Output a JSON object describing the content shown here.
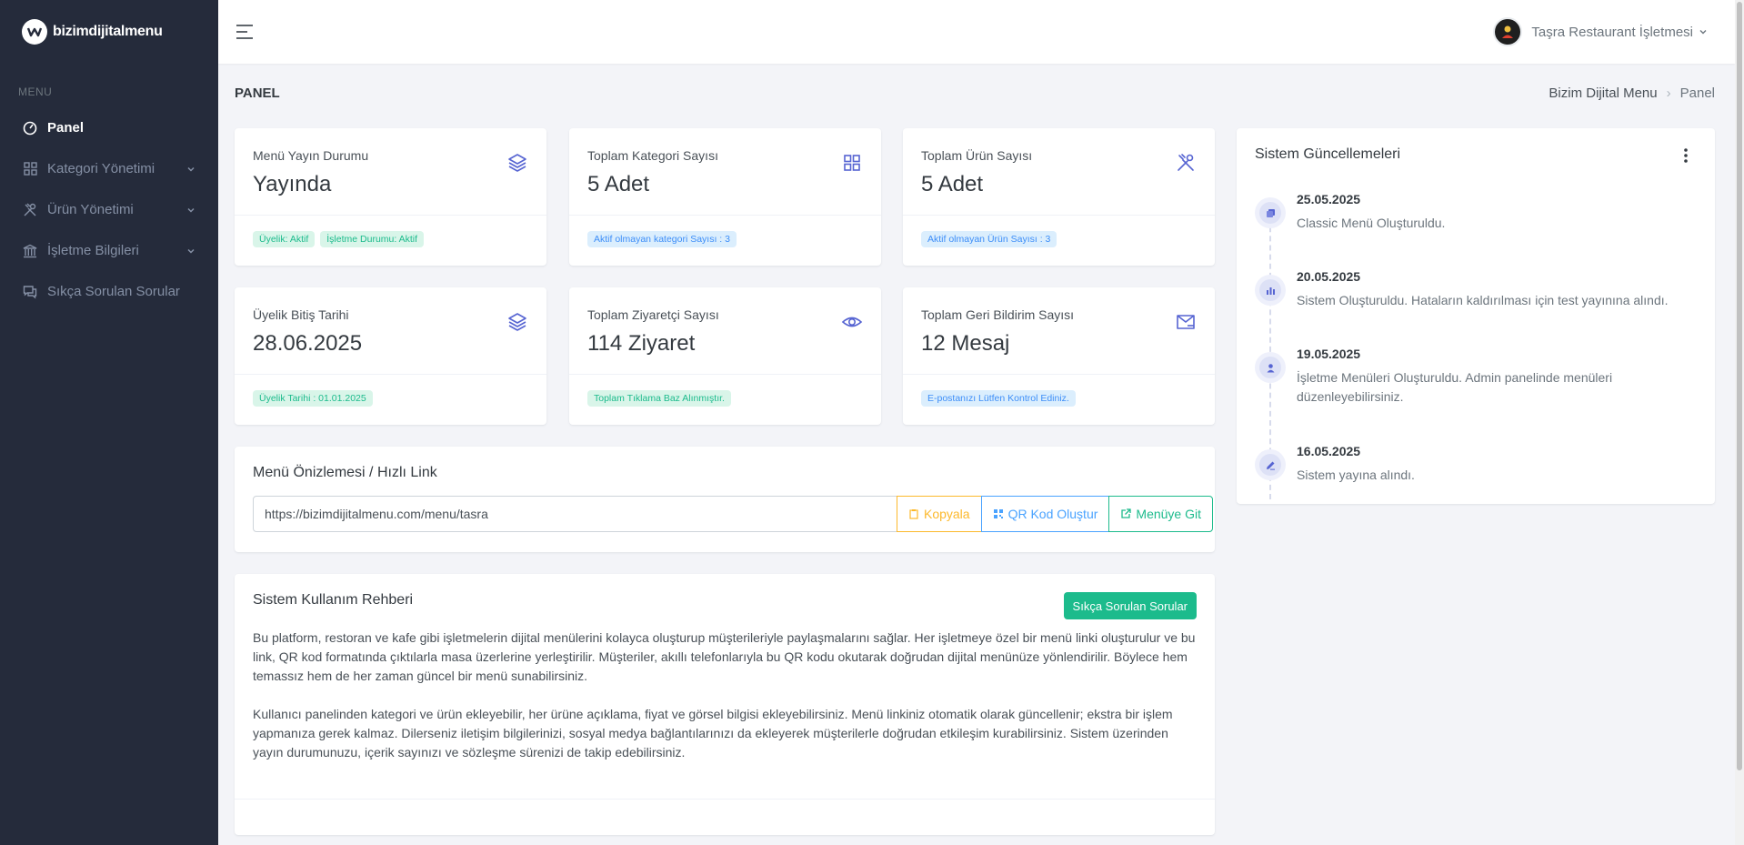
{
  "brand": {
    "name": "bizimdijitalmenu"
  },
  "sidebar": {
    "menu_title": "MENU",
    "items": [
      {
        "label": "Panel",
        "icon": "dashboard-icon"
      },
      {
        "label": "Kategori Yönetimi",
        "icon": "grid-icon"
      },
      {
        "label": "Ürün Yönetimi",
        "icon": "utensils-icon"
      },
      {
        "label": "İşletme Bilgileri",
        "icon": "building-icon"
      },
      {
        "label": "Sıkça Sorulan Sorular",
        "icon": "chat-icon"
      }
    ]
  },
  "topbar": {
    "user_name": "Taşra Restaurant İşletmesi"
  },
  "page": {
    "title": "PANEL",
    "breadcrumb": {
      "root": "Bizim Dijital Menu",
      "current": "Panel"
    }
  },
  "stats": [
    {
      "label": "Menü Yayın Durumu",
      "value": "Yayında",
      "badges": [
        "Üyelik: Aktif",
        "İşletme Durumu: Aktif"
      ]
    },
    {
      "label": "Toplam Kategori Sayısı",
      "value": "5 Adet",
      "badges": [
        "Aktif olmayan kategori Sayısı : 3"
      ]
    },
    {
      "label": "Toplam Ürün Sayısı",
      "value": "5 Adet",
      "badges": [
        "Aktif olmayan Ürün Sayısı : 3"
      ]
    },
    {
      "label": "Üyelik Bitiş Tarihi",
      "value": "28.06.2025",
      "badges": [
        "Üyelik Tarihi : 01.01.2025"
      ]
    },
    {
      "label": "Toplam Ziyaretçi Sayısı",
      "value": "114 Ziyaret",
      "badges": [
        "Toplam Tıklama Baz Alınmıştır."
      ]
    },
    {
      "label": "Toplam Geri Bildirim Sayısı",
      "value": "12 Mesaj",
      "badges": [
        "E-postanızı Lütfen Kontrol Ediniz."
      ]
    }
  ],
  "quick_link": {
    "title": "Menü Önizlemesi / Hızlı Link",
    "url": "https://bizimdijitalmenu.com/menu/tasra",
    "copy_label": "Kopyala",
    "qr_label": "QR Kod Oluştur",
    "go_label": "Menüye Git"
  },
  "guide": {
    "title": "Sistem Kullanım Rehberi",
    "faq_button": "Sıkça Sorulan Sorular",
    "paragraphs": [
      "Bu platform, restoran ve kafe gibi işletmelerin dijital menülerini kolayca oluşturup müşterileriyle paylaşmalarını sağlar. Her işletmeye özel bir menü linki oluşturulur ve bu link, QR kod formatında çıktılarla masa üzerlerine yerleştirilir. Müşteriler, akıllı telefonlarıyla bu QR kodu okutarak doğrudan dijital menünüze yönlendirilir. Böylece hem temassız hem de her zaman güncel bir menü sunabilirsiniz.",
      "Kullanıcı panelinden kategori ve ürün ekleyebilir, her ürüne açıklama, fiyat ve görsel bilgisi ekleyebilirsiniz. Menü linkiniz otomatik olarak güncellenir; ekstra bir işlem yapmanıza gerek kalmaz. Dilerseniz iletişim bilgilerinizi, sosyal medya bağlantılarınızı da ekleyerek müşterilerle doğrudan etkileşim kurabilirsiniz. Sistem üzerinden yayın durumunuzu, içerik sayınızı ve sözleşme sürenizi de takip edebilirsiniz."
    ]
  },
  "updates": {
    "title": "Sistem Güncellemeleri",
    "items": [
      {
        "date": "25.05.2025",
        "text": "Classic Menü Oluşturuldu.",
        "icon": "copy-icon"
      },
      {
        "date": "20.05.2025",
        "text": "Sistem Oluşturuldu. Hataların kaldırılması için test yayınına alındı.",
        "icon": "bar-chart-icon"
      },
      {
        "date": "19.05.2025",
        "text": "İşletme Menüleri Oluşturuldu. Admin panelinde menüleri düzenleyebilirsiniz.",
        "icon": "user-icon"
      },
      {
        "date": "16.05.2025",
        "text": "Sistem yayına alındı.",
        "icon": "edit-icon"
      }
    ]
  },
  "colors": {
    "sidebar_bg": "#252b3b",
    "primary": "#5664d2",
    "success": "#1cbb8c",
    "info": "#4aa3ff",
    "warning": "#fcb92c"
  }
}
